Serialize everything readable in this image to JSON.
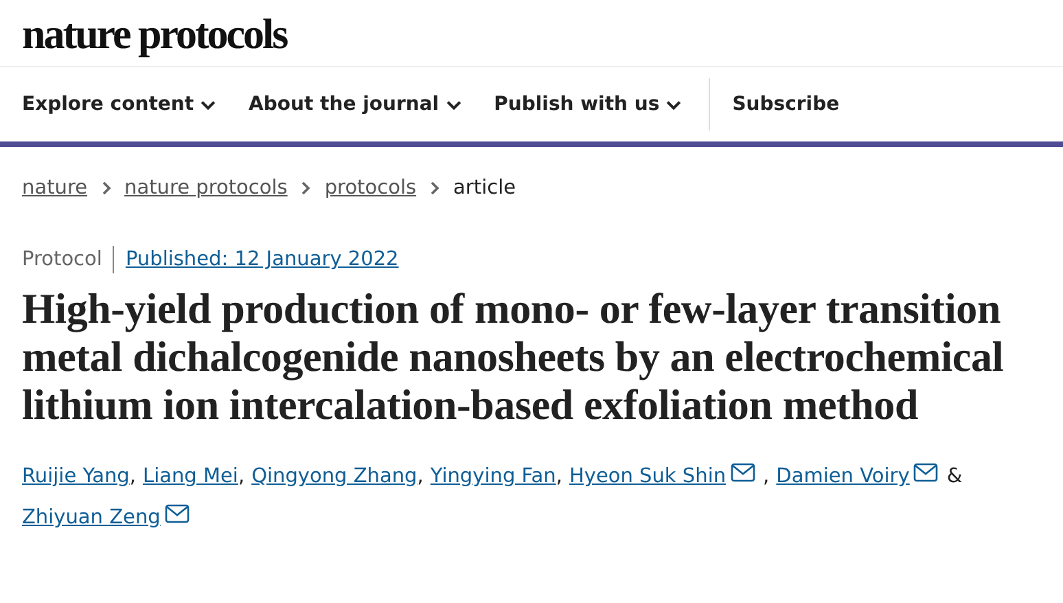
{
  "logo": "nature protocols",
  "nav": [
    {
      "label": "Explore content",
      "dropdown": true
    },
    {
      "label": "About the journal",
      "dropdown": true
    },
    {
      "label": "Publish with us",
      "dropdown": true
    },
    {
      "label": "Subscribe",
      "dropdown": false
    }
  ],
  "breadcrumbs": [
    {
      "label": "nature",
      "link": true
    },
    {
      "label": "nature protocols",
      "link": true
    },
    {
      "label": "protocols",
      "link": true
    },
    {
      "label": "article",
      "link": false
    }
  ],
  "article_type": "Protocol",
  "published": "Published: 12 January 2022",
  "title": "High-yield production of mono- or few-layer transition metal dichalcogenide nanosheets by an electrochemical lithium ion intercalation-based exfoliation method",
  "authors": [
    {
      "name": "Ruijie Yang",
      "email": false,
      "after": ","
    },
    {
      "name": "Liang Mei",
      "email": false,
      "after": ","
    },
    {
      "name": "Qingyong Zhang",
      "email": false,
      "after": ","
    },
    {
      "name": "Yingying Fan",
      "email": false,
      "after": ","
    },
    {
      "name": "Hyeon Suk Shin",
      "email": true,
      "after": ","
    },
    {
      "name": "Damien Voiry",
      "email": true,
      "after": "&"
    },
    {
      "name": "Zhiyuan Zeng",
      "email": true
    }
  ]
}
